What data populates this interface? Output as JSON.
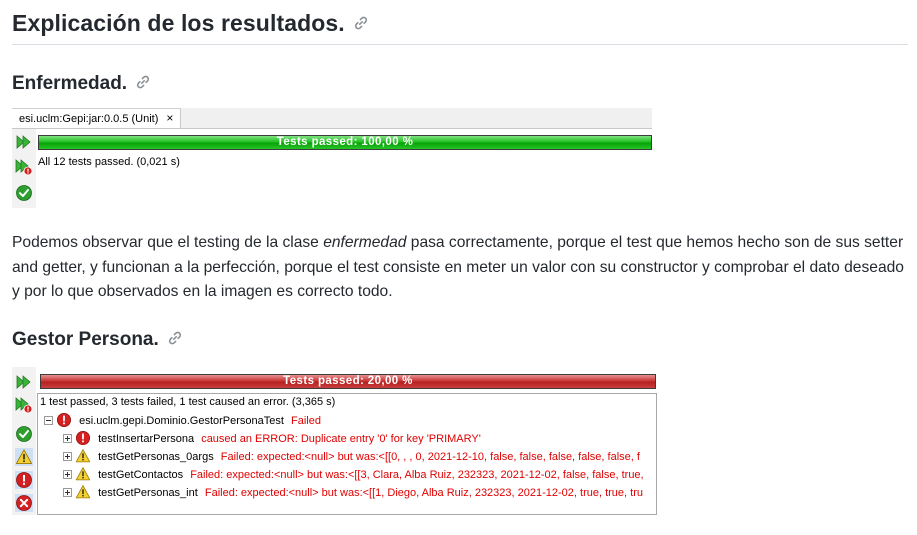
{
  "heading_main": "Explicación de los resultados.",
  "heading_enfermedad": "Enfermedad.",
  "heading_gestor": "Gestor Persona.",
  "panel1": {
    "tab_label": "esi.uclm:Gepi:jar:0.0.5 (Unit)",
    "tab_close": "×",
    "progress_label": "Tests passed: 100,00 %",
    "progress_fraction": 1.0,
    "summary": "All 12 tests passed. (0,021 s)"
  },
  "paragraph": {
    "part1": "Podemos observar que el testing de la clase ",
    "emph": "enfermedad",
    "part2": " pasa correctamente, porque el test que hemos hecho son de sus setter and getter, y funcionan a la perfección, porque el test consiste en meter un valor con su constructor y comprobar el dato deseado y por lo que observados en la imagen es correcto todo."
  },
  "panel2": {
    "progress_label": "Tests passed: 20,00 %",
    "progress_fraction": 0.2,
    "summary": "1 test passed, 3 tests failed, 1 test caused an error. (3,365 s)",
    "suite": {
      "name": "esi.uclm.gepi.Dominio.GestorPersonaTest",
      "status": "Failed"
    },
    "tests": [
      {
        "name": "testInsertarPersona",
        "message": "caused an ERROR: Duplicate entry '0' for key 'PRIMARY'",
        "icon": "error-icon"
      },
      {
        "name": "testGetPersonas_0args",
        "message": "Failed: expected:<null> but was:<[[0, , , 0, 2021-12-10, false, false, false, false, false, f",
        "icon": "warning-icon"
      },
      {
        "name": "testGetContactos",
        "message": "Failed: expected:<null> but was:<[[3, Clara, Alba Ruiz, 232323, 2021-12-02, false, false, true,",
        "icon": "warning-icon"
      },
      {
        "name": "testGetPersonas_int",
        "message": "Failed: expected:<null> but was:<[[1, Diego, Alba Ruiz, 232323, 2021-12-02, true, true, tru",
        "icon": "warning-icon"
      }
    ]
  }
}
